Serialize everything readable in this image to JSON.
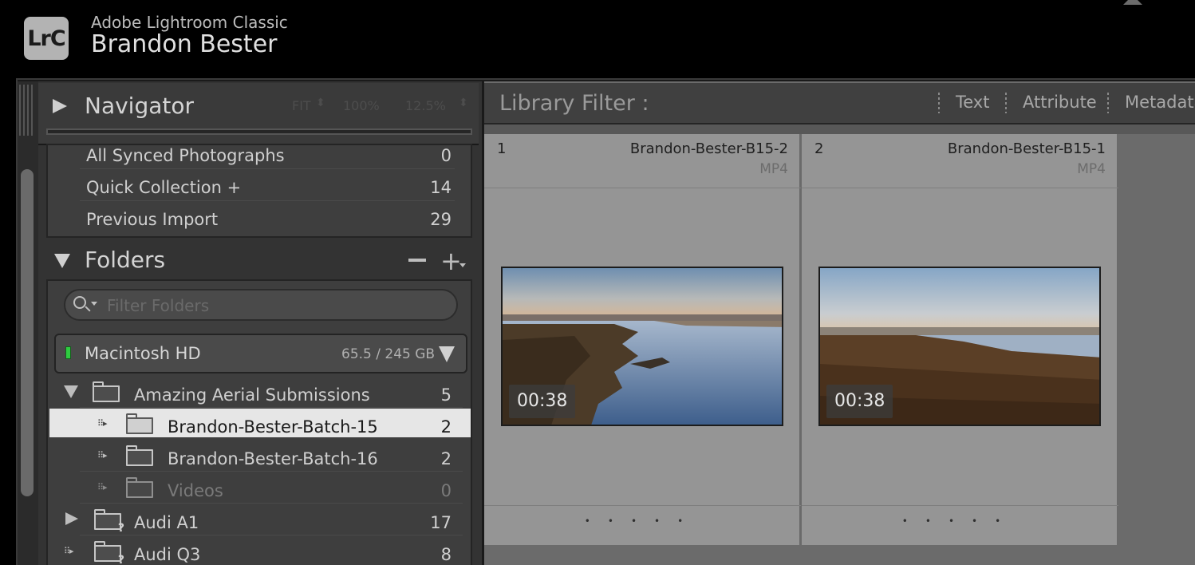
{
  "identity": {
    "logo_text": "LrC",
    "app_name": "Adobe Lightroom Classic",
    "user_name": "Brandon Bester"
  },
  "navigator": {
    "title": "Navigator",
    "zoom_fit": "FIT",
    "zoom_100": "100%",
    "zoom_125": "12.5%"
  },
  "catalog": [
    {
      "label": "All Synced Photographs",
      "count": "0"
    },
    {
      "label": "Quick Collection +",
      "count": "14"
    },
    {
      "label": "Previous Import",
      "count": "29"
    }
  ],
  "folders": {
    "title": "Folders",
    "filter_placeholder": "Filter Folders",
    "volume": {
      "name": "Macintosh HD",
      "size": "65.5 / 245 GB"
    },
    "items": [
      {
        "label": "Amazing Aerial Submissions",
        "count": "5"
      },
      {
        "label": "Brandon-Bester-Batch-15",
        "count": "2"
      },
      {
        "label": "Brandon-Bester-Batch-16",
        "count": "2"
      },
      {
        "label": "Videos",
        "count": "0"
      },
      {
        "label": "Audi A1",
        "count": "17"
      },
      {
        "label": "Audi Q3",
        "count": "8"
      }
    ]
  },
  "library_filter": {
    "title": "Library Filter :",
    "tabs": [
      "Text",
      "Attribute",
      "Metadata"
    ]
  },
  "grid": [
    {
      "index": "1",
      "name": "Brandon-Bester-B15-2",
      "ext": "MP4",
      "duration": "00:38"
    },
    {
      "index": "2",
      "name": "Brandon-Bester-B15-1",
      "ext": "MP4",
      "duration": "00:38"
    }
  ],
  "colors": {
    "selection": "#e6e6e6",
    "volume_led": "#2ecc40",
    "panel": "#333333",
    "grid_cell": "#959595"
  }
}
